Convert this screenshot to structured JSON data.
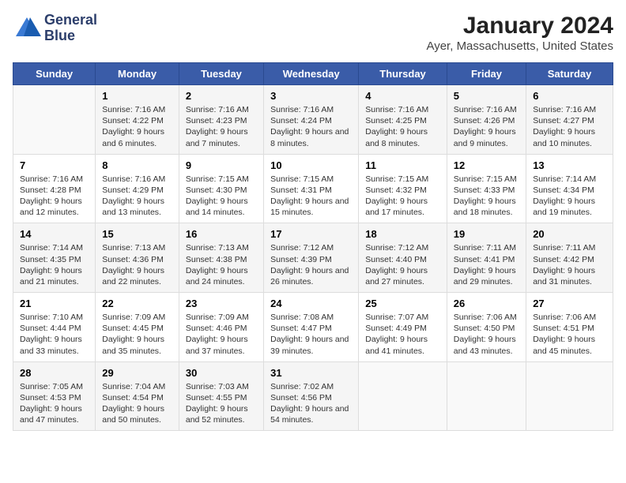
{
  "header": {
    "logo_line1": "General",
    "logo_line2": "Blue",
    "title": "January 2024",
    "subtitle": "Ayer, Massachusetts, United States"
  },
  "days_of_week": [
    "Sunday",
    "Monday",
    "Tuesday",
    "Wednesday",
    "Thursday",
    "Friday",
    "Saturday"
  ],
  "weeks": [
    [
      {
        "day": "",
        "info": ""
      },
      {
        "day": "1",
        "sunrise": "Sunrise: 7:16 AM",
        "sunset": "Sunset: 4:22 PM",
        "daylight": "Daylight: 9 hours and 6 minutes."
      },
      {
        "day": "2",
        "sunrise": "Sunrise: 7:16 AM",
        "sunset": "Sunset: 4:23 PM",
        "daylight": "Daylight: 9 hours and 7 minutes."
      },
      {
        "day": "3",
        "sunrise": "Sunrise: 7:16 AM",
        "sunset": "Sunset: 4:24 PM",
        "daylight": "Daylight: 9 hours and 8 minutes."
      },
      {
        "day": "4",
        "sunrise": "Sunrise: 7:16 AM",
        "sunset": "Sunset: 4:25 PM",
        "daylight": "Daylight: 9 hours and 8 minutes."
      },
      {
        "day": "5",
        "sunrise": "Sunrise: 7:16 AM",
        "sunset": "Sunset: 4:26 PM",
        "daylight": "Daylight: 9 hours and 9 minutes."
      },
      {
        "day": "6",
        "sunrise": "Sunrise: 7:16 AM",
        "sunset": "Sunset: 4:27 PM",
        "daylight": "Daylight: 9 hours and 10 minutes."
      }
    ],
    [
      {
        "day": "7",
        "sunrise": "Sunrise: 7:16 AM",
        "sunset": "Sunset: 4:28 PM",
        "daylight": "Daylight: 9 hours and 12 minutes."
      },
      {
        "day": "8",
        "sunrise": "Sunrise: 7:16 AM",
        "sunset": "Sunset: 4:29 PM",
        "daylight": "Daylight: 9 hours and 13 minutes."
      },
      {
        "day": "9",
        "sunrise": "Sunrise: 7:15 AM",
        "sunset": "Sunset: 4:30 PM",
        "daylight": "Daylight: 9 hours and 14 minutes."
      },
      {
        "day": "10",
        "sunrise": "Sunrise: 7:15 AM",
        "sunset": "Sunset: 4:31 PM",
        "daylight": "Daylight: 9 hours and 15 minutes."
      },
      {
        "day": "11",
        "sunrise": "Sunrise: 7:15 AM",
        "sunset": "Sunset: 4:32 PM",
        "daylight": "Daylight: 9 hours and 17 minutes."
      },
      {
        "day": "12",
        "sunrise": "Sunrise: 7:15 AM",
        "sunset": "Sunset: 4:33 PM",
        "daylight": "Daylight: 9 hours and 18 minutes."
      },
      {
        "day": "13",
        "sunrise": "Sunrise: 7:14 AM",
        "sunset": "Sunset: 4:34 PM",
        "daylight": "Daylight: 9 hours and 19 minutes."
      }
    ],
    [
      {
        "day": "14",
        "sunrise": "Sunrise: 7:14 AM",
        "sunset": "Sunset: 4:35 PM",
        "daylight": "Daylight: 9 hours and 21 minutes."
      },
      {
        "day": "15",
        "sunrise": "Sunrise: 7:13 AM",
        "sunset": "Sunset: 4:36 PM",
        "daylight": "Daylight: 9 hours and 22 minutes."
      },
      {
        "day": "16",
        "sunrise": "Sunrise: 7:13 AM",
        "sunset": "Sunset: 4:38 PM",
        "daylight": "Daylight: 9 hours and 24 minutes."
      },
      {
        "day": "17",
        "sunrise": "Sunrise: 7:12 AM",
        "sunset": "Sunset: 4:39 PM",
        "daylight": "Daylight: 9 hours and 26 minutes."
      },
      {
        "day": "18",
        "sunrise": "Sunrise: 7:12 AM",
        "sunset": "Sunset: 4:40 PM",
        "daylight": "Daylight: 9 hours and 27 minutes."
      },
      {
        "day": "19",
        "sunrise": "Sunrise: 7:11 AM",
        "sunset": "Sunset: 4:41 PM",
        "daylight": "Daylight: 9 hours and 29 minutes."
      },
      {
        "day": "20",
        "sunrise": "Sunrise: 7:11 AM",
        "sunset": "Sunset: 4:42 PM",
        "daylight": "Daylight: 9 hours and 31 minutes."
      }
    ],
    [
      {
        "day": "21",
        "sunrise": "Sunrise: 7:10 AM",
        "sunset": "Sunset: 4:44 PM",
        "daylight": "Daylight: 9 hours and 33 minutes."
      },
      {
        "day": "22",
        "sunrise": "Sunrise: 7:09 AM",
        "sunset": "Sunset: 4:45 PM",
        "daylight": "Daylight: 9 hours and 35 minutes."
      },
      {
        "day": "23",
        "sunrise": "Sunrise: 7:09 AM",
        "sunset": "Sunset: 4:46 PM",
        "daylight": "Daylight: 9 hours and 37 minutes."
      },
      {
        "day": "24",
        "sunrise": "Sunrise: 7:08 AM",
        "sunset": "Sunset: 4:47 PM",
        "daylight": "Daylight: 9 hours and 39 minutes."
      },
      {
        "day": "25",
        "sunrise": "Sunrise: 7:07 AM",
        "sunset": "Sunset: 4:49 PM",
        "daylight": "Daylight: 9 hours and 41 minutes."
      },
      {
        "day": "26",
        "sunrise": "Sunrise: 7:06 AM",
        "sunset": "Sunset: 4:50 PM",
        "daylight": "Daylight: 9 hours and 43 minutes."
      },
      {
        "day": "27",
        "sunrise": "Sunrise: 7:06 AM",
        "sunset": "Sunset: 4:51 PM",
        "daylight": "Daylight: 9 hours and 45 minutes."
      }
    ],
    [
      {
        "day": "28",
        "sunrise": "Sunrise: 7:05 AM",
        "sunset": "Sunset: 4:53 PM",
        "daylight": "Daylight: 9 hours and 47 minutes."
      },
      {
        "day": "29",
        "sunrise": "Sunrise: 7:04 AM",
        "sunset": "Sunset: 4:54 PM",
        "daylight": "Daylight: 9 hours and 50 minutes."
      },
      {
        "day": "30",
        "sunrise": "Sunrise: 7:03 AM",
        "sunset": "Sunset: 4:55 PM",
        "daylight": "Daylight: 9 hours and 52 minutes."
      },
      {
        "day": "31",
        "sunrise": "Sunrise: 7:02 AM",
        "sunset": "Sunset: 4:56 PM",
        "daylight": "Daylight: 9 hours and 54 minutes."
      },
      {
        "day": "",
        "info": ""
      },
      {
        "day": "",
        "info": ""
      },
      {
        "day": "",
        "info": ""
      }
    ]
  ]
}
